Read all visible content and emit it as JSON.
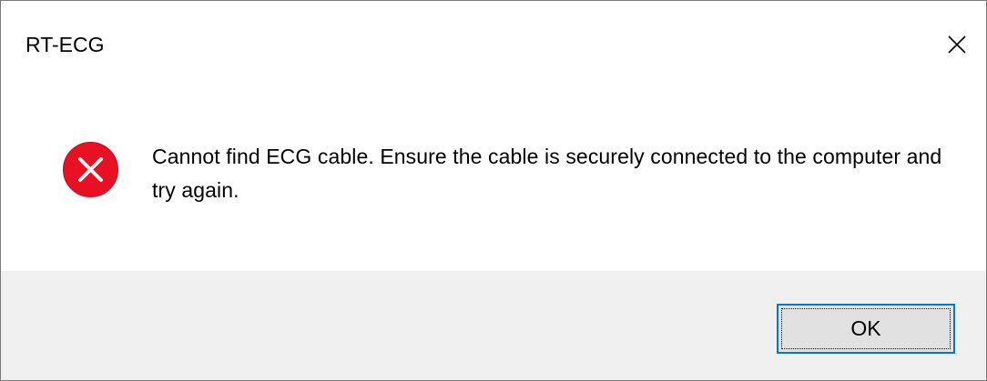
{
  "window": {
    "title": "RT-ECG",
    "close_icon": "close-icon"
  },
  "message": {
    "icon": "error-icon",
    "icon_color": "#e81123",
    "text": "Cannot find ECG cable. Ensure the cable is securely connected to the computer and try again."
  },
  "buttons": {
    "ok_label": "OK"
  },
  "colors": {
    "footer_bg": "#f0f0f0",
    "button_focus_border": "#0078d7"
  }
}
